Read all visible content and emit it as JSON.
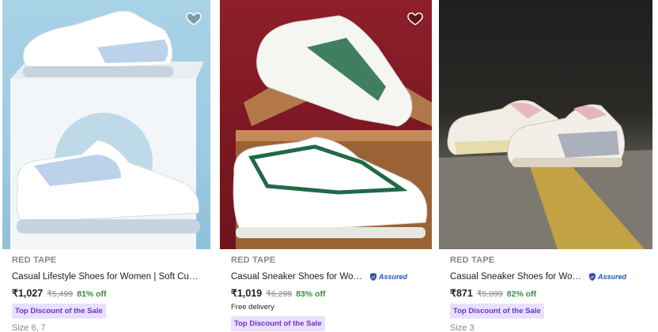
{
  "products": [
    {
      "brand": "RED TAPE",
      "title": "Casual Lifestyle Shoes for Women | Soft Cushioned Insole",
      "assured": "",
      "price": "₹1,027",
      "mrp": "₹5,499",
      "discount": "81% off",
      "delivery": "",
      "badge": "Top Discount of the Sale",
      "size": "Size 6, 7"
    },
    {
      "brand": "RED TAPE",
      "title": "Casual Sneaker Shoes for Women...",
      "assured": "Assured",
      "price": "₹1,019",
      "mrp": "₹6,299",
      "discount": "83% off",
      "delivery": "Free delivery",
      "badge": "Top Discount of the Sale",
      "size": ""
    },
    {
      "brand": "RED TAPE",
      "title": "Casual Sneaker Shoes for Women...",
      "assured": "Assured",
      "price": "₹871",
      "mrp": "₹5,099",
      "discount": "82% off",
      "delivery": "",
      "badge": "Top Discount of the Sale",
      "size": "Size 3"
    }
  ],
  "icons": {
    "wishlist": "heart-icon",
    "assured": "shield-check-icon"
  },
  "colors": {
    "discount": "#388e3c",
    "badge_bg": "#e9e0ff",
    "badge_text": "#6a35c9",
    "assured": "#2455b9"
  }
}
